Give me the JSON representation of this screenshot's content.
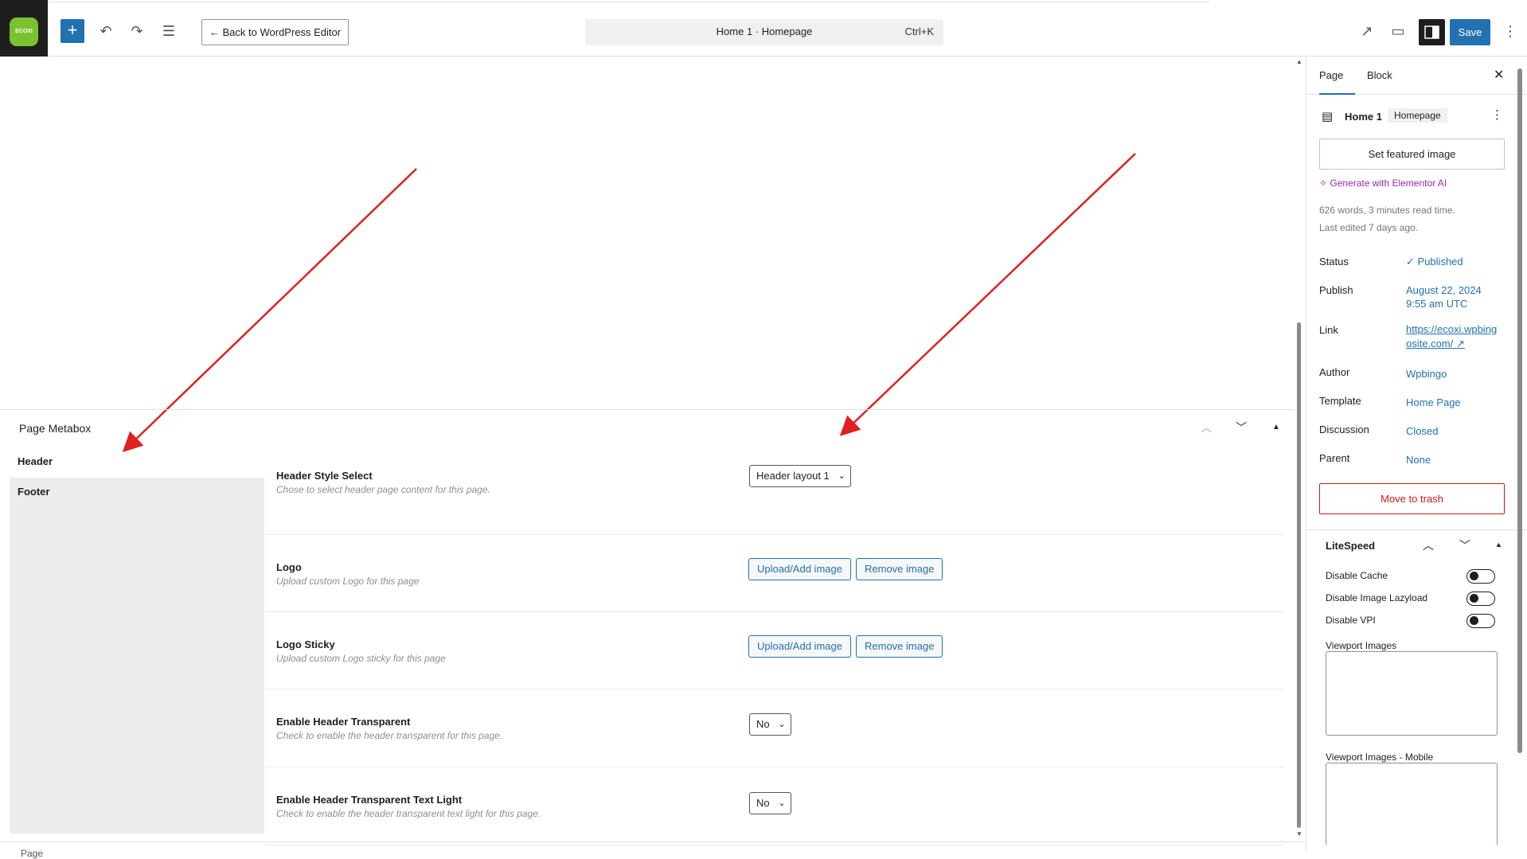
{
  "toolbar": {
    "logo_text": "ECOXI",
    "back_label": "← Back to WordPress Editor",
    "command_title": "Home 1 · Homepage",
    "command_shortcut": "Ctrl+K",
    "save_label": "Save"
  },
  "metabox": {
    "title": "Page Metabox",
    "tabs": [
      "Header",
      "Footer"
    ],
    "rows": [
      {
        "label": "Header Style Select",
        "desc": "Chose to select header page content for this page.",
        "control": "Header layout 1"
      },
      {
        "label": "Logo",
        "desc": "Upload custom Logo for this page",
        "upload": "Upload/Add image",
        "remove": "Remove image"
      },
      {
        "label": "Logo Sticky",
        "desc": "Upload custom Logo sticky for this page",
        "upload": "Upload/Add image",
        "remove": "Remove image"
      },
      {
        "label": "Enable Header Transparent",
        "desc": "Check to enable the header transparent for this page.",
        "control": "No"
      },
      {
        "label": "Enable Header Transparent Text Light",
        "desc": "Check to enable the header transparent text light for this page.",
        "control": "No"
      }
    ]
  },
  "sidebar": {
    "tab_page": "Page",
    "tab_block": "Block",
    "page_title": "Home 1",
    "page_badge": "Homepage",
    "featured_btn": "Set featured image",
    "ai_link": "Generate with Elementor AI",
    "stats_line1": "626 words, 3 minutes read time.",
    "stats_line2": "Last edited 7 days ago.",
    "fields": [
      {
        "label": "Status",
        "value": "Published"
      },
      {
        "label": "Publish",
        "value": "August 22, 2024"
      },
      {
        "label": "",
        "value": "9:55 am UTC"
      },
      {
        "label": "Link",
        "value": "https://ecoxi.wpbing"
      },
      {
        "label": "",
        "value": "osite.com/ ↗"
      },
      {
        "label": "Author",
        "value": "Wpbingo"
      },
      {
        "label": "Template",
        "value": "Home Page"
      },
      {
        "label": "Discussion",
        "value": "Closed"
      },
      {
        "label": "Parent",
        "value": "None"
      }
    ],
    "trash_btn": "Move to trash",
    "litespeed_title": "LiteSpeed",
    "toggles": [
      "Disable Cache",
      "Disable Image Lazyload",
      "Disable VPI"
    ],
    "viewport_label": "Viewport Images",
    "viewport_mobile_label": "Viewport Images - Mobile"
  },
  "footer": {
    "breadcrumb": "Page"
  }
}
